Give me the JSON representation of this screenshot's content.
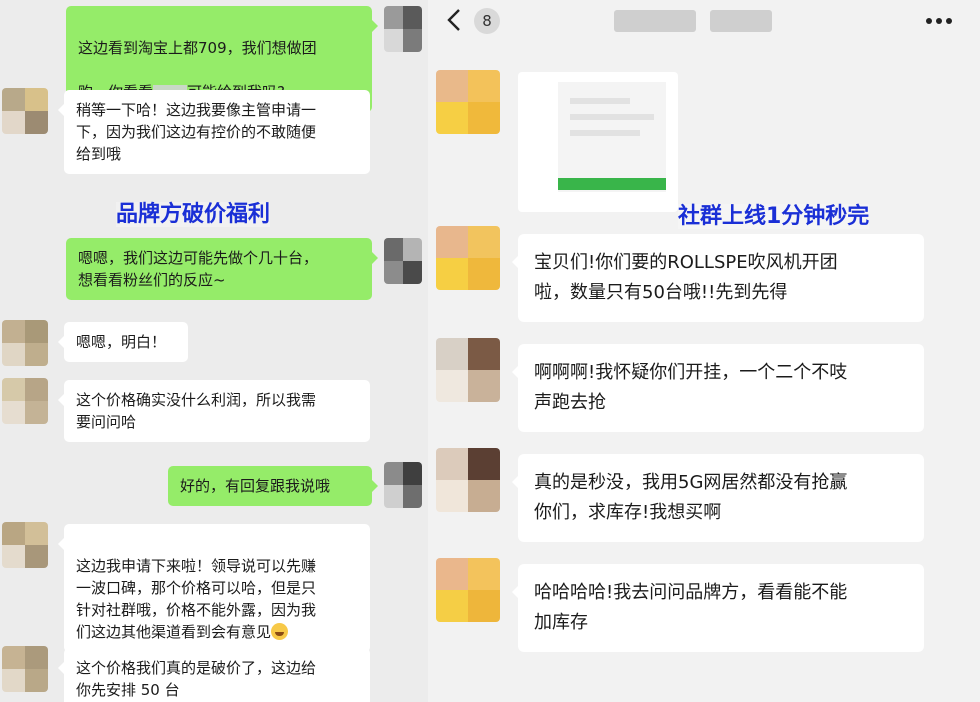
{
  "left": {
    "messages": [
      {
        "line1": "这边看到淘宝上都709，我们想做团",
        "line2_pre": "购，你看看",
        "line2_post": "可能给到我吗?"
      },
      {
        "text": "稍等一下哈！这边我要像主管申请一\n下，因为我们这边有控价的不敢随便\n给到哦"
      },
      {
        "text": "嗯嗯，我们这边可能先做个几十台，\n想看看粉丝们的反应~"
      },
      {
        "text": "嗯嗯，明白！"
      },
      {
        "text": "这个价格确实没什么利润，所以我需\n要问问哈"
      },
      {
        "text": "好的，有回复跟我说哦"
      },
      {
        "text": "这边我申请下来啦！领导说可以先赚\n一波口碑，那个价格可以哈，但是只\n针对社群哦，价格不能外露，因为我\n们这边其他渠道看到会有意见"
      },
      {
        "text": "这个价格我们真的是破价了，这边给\n你先安排 50 台"
      }
    ],
    "caption": "品牌方破价福利"
  },
  "right": {
    "header": {
      "badge": "8"
    },
    "messages": [
      {
        "text": "宝贝们!你们要的ROLLSPE吹风机开团\n啦，数量只有50台哦!!先到先得"
      },
      {
        "text": "啊啊啊!我怀疑你们开挂，一个二个不吱\n声跑去抢"
      },
      {
        "text": "真的是秒没，我用5G网居然都没有抢赢\n你们，求库存!我想买啊"
      },
      {
        "text": "哈哈哈哈!我去问问品牌方，看看能不能\n加库存"
      }
    ],
    "caption": "社群上线1分钟秒完"
  },
  "colors": {
    "sent_bubble": "#95ec69",
    "received_bubble": "#ffffff",
    "caption_text": "#1a2fd6"
  },
  "icons": {
    "back": "chevron-left-icon",
    "more": "more-dots-icon",
    "emoji": "grin-sweat-emoji-icon"
  }
}
